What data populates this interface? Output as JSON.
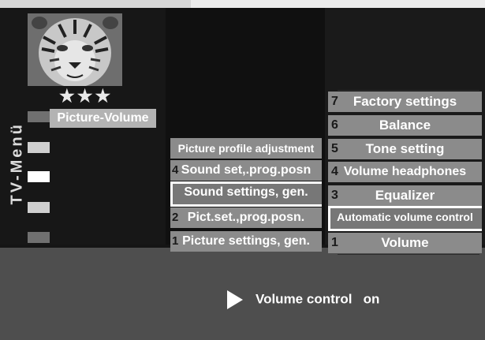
{
  "menu_title": "TV-Menü",
  "rating_stars": "★★★",
  "left_menu": {
    "selected_label": "Picture-Volume"
  },
  "middle_menu": [
    {
      "num": "",
      "label": "Picture profile adjustment"
    },
    {
      "num": "4",
      "label": "Sound set,.prog.posn"
    },
    {
      "num": "",
      "label": "Sound settings, gen."
    },
    {
      "num": "2",
      "label": "Pict.set.,prog.posn."
    },
    {
      "num": "1",
      "label": "Picture settings, gen."
    }
  ],
  "right_menu": [
    {
      "num": "7",
      "label": "Factory settings"
    },
    {
      "num": "6",
      "label": "Balance"
    },
    {
      "num": "5",
      "label": "Tone setting"
    },
    {
      "num": "4",
      "label": "Volume headphones"
    },
    {
      "num": "3",
      "label": "Equalizer"
    },
    {
      "num": "",
      "label": "Automatic volume control"
    },
    {
      "num": "1",
      "label": "Volume"
    }
  ],
  "status": {
    "label": "Volume control",
    "value": "on"
  }
}
